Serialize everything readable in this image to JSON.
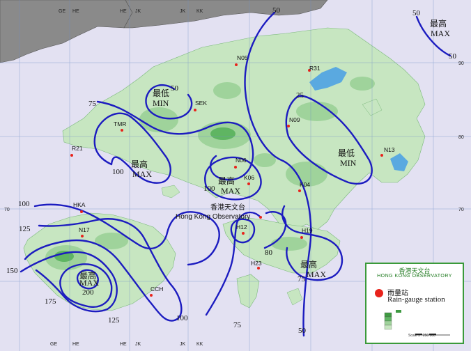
{
  "stations": [
    {
      "id": "N05"
    },
    {
      "id": "R31"
    },
    {
      "id": "SEK"
    },
    {
      "id": "N09"
    },
    {
      "id": "TMR"
    },
    {
      "id": "R21"
    },
    {
      "id": "N13"
    },
    {
      "id": "N06"
    },
    {
      "id": "K06"
    },
    {
      "id": "K04"
    },
    {
      "id": "HKA"
    },
    {
      "id": "H12"
    },
    {
      "id": "N17"
    },
    {
      "id": "H19"
    },
    {
      "id": "H23"
    },
    {
      "id": "CCH"
    }
  ],
  "observatory": {
    "name_cn": "香港天文台",
    "name_en": "Hong Kong Observatory"
  },
  "isohyet_labels": [
    "50",
    "50",
    "50",
    "25",
    "75",
    "100",
    "100",
    "125",
    "150",
    "175",
    "200",
    "125",
    "100",
    "75",
    "50",
    "100",
    "80",
    "75",
    "50"
  ],
  "extremes": [
    {
      "cn": "最高",
      "en": "MAX"
    },
    {
      "cn": "最低",
      "en": "MIN"
    },
    {
      "cn": "最低",
      "en": "MIN"
    },
    {
      "cn": "最高",
      "en": "MAX"
    },
    {
      "cn": "最高",
      "en": "MAX"
    },
    {
      "cn": "最高",
      "en": "MAX"
    },
    {
      "cn": "最高",
      "en": "MAX"
    }
  ],
  "grid_labels_top": [
    "GE",
    "HE",
    "HE",
    "JK",
    "JK",
    "KK"
  ],
  "grid_labels_bottom": [
    "GE",
    "HE",
    "HE",
    "JK",
    "JK",
    "KK"
  ],
  "grid_labels_right": [
    "90",
    "80",
    "70",
    "60"
  ],
  "legend": {
    "title_cn": "香港天文台",
    "title_en": "HONG KONG OBSERVATORY",
    "symbol_cn": "雨量站",
    "symbol_en": "Rain-gauge station",
    "scale": "Scale 1 : 250 000"
  },
  "colors": {
    "sea": "#e3e1f2",
    "land_light": "#c7e6c1",
    "land_mid": "#9fd39b",
    "land_dark": "#5fb562",
    "mainland": "#8a8a8a",
    "isohyet": "#1c1cc0",
    "station": "#e8231b",
    "reservoir": "#5aa9e0"
  }
}
